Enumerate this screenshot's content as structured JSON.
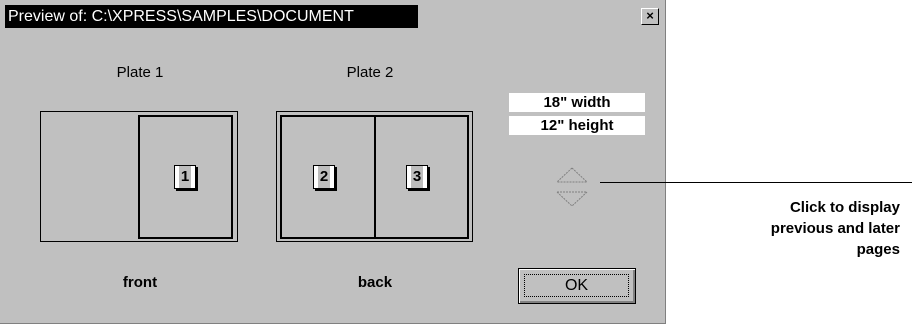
{
  "window": {
    "title": "Preview of: C:\\XPRESS\\SAMPLES\\DOCUMENT",
    "close_glyph": "×"
  },
  "plates": {
    "plate1": {
      "label": "Plate 1",
      "side": "front",
      "pages": [
        "1"
      ]
    },
    "plate2": {
      "label": "Plate 2",
      "side": "back",
      "pages": [
        "2",
        "3"
      ]
    }
  },
  "dimensions": {
    "width": "18\" width",
    "height": "12\" height"
  },
  "navigation": {
    "up_icon": "triangle-up-outline-icon",
    "down_icon": "triangle-down-outline-icon"
  },
  "ok_label": "OK",
  "callout": {
    "lines": [
      "Click to display",
      "previous and later",
      "pages"
    ]
  },
  "colors": {
    "face": "#c0c0c0",
    "title_bar": "#000000",
    "page_highlight": "#bdbdbd"
  }
}
